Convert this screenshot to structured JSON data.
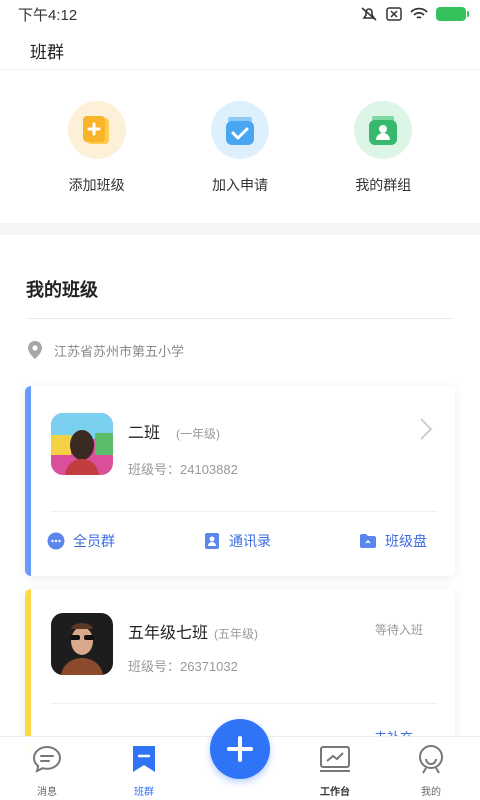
{
  "status_bar": {
    "time": "下午4:12"
  },
  "header": {
    "title": "班群"
  },
  "quick_actions": [
    {
      "label": "添加班级",
      "icon": "add-class-icon",
      "color": "#f7b733"
    },
    {
      "label": "加入申请",
      "icon": "join-request-icon",
      "color": "#4aa8f5"
    },
    {
      "label": "我的群组",
      "icon": "my-groups-icon",
      "color": "#3ec27a"
    }
  ],
  "my_classes": {
    "title": "我的班级",
    "school": "江苏省苏州市第五小学",
    "classes": [
      {
        "name": "二班",
        "grade": "(一年级)",
        "class_no": "班级号：24103882",
        "accent": "#6b9bff",
        "actions": [
          {
            "label": "全员群",
            "icon": "chat-bubble-icon"
          },
          {
            "label": "通讯录",
            "icon": "contacts-icon"
          },
          {
            "label": "班级盘",
            "icon": "folder-icon"
          }
        ]
      },
      {
        "name": "五年级七班",
        "grade": "(五年级)",
        "class_no": "班级号：26371032",
        "status": "等待入班",
        "partial_action": "去补充",
        "accent": "#ffd84a"
      }
    ]
  },
  "bottom_nav": {
    "items": [
      {
        "label": "消息",
        "icon": "message-icon"
      },
      {
        "label": "班群",
        "icon": "class-group-icon",
        "active": true
      },
      {
        "label": "工作台",
        "icon": "workbench-icon"
      },
      {
        "label": "我的",
        "icon": "profile-icon"
      }
    ],
    "primary_color": "#2f74f6"
  }
}
